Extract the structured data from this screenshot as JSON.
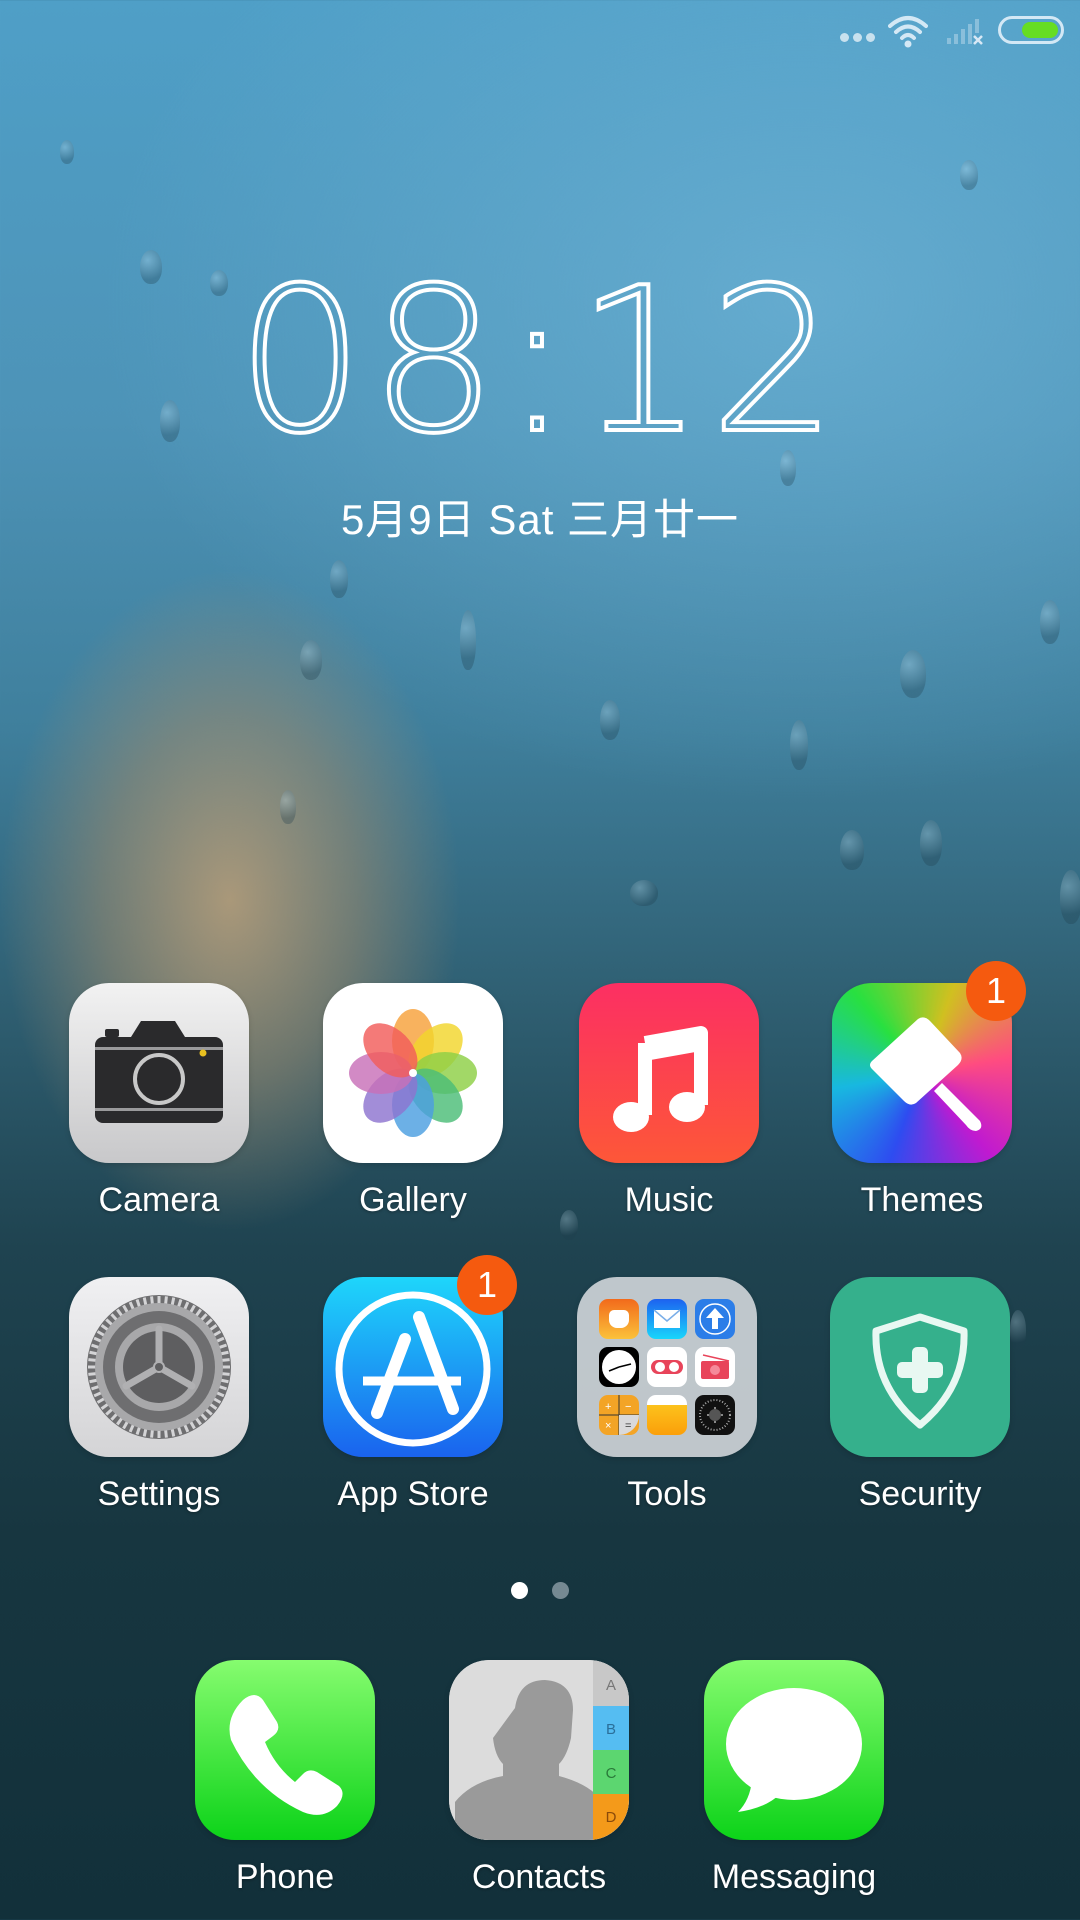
{
  "status_bar": {
    "more_icon": "ellipsis-icon",
    "wifi_icon": "wifi-icon",
    "signal_icon": "no-signal-icon",
    "battery_icon": "battery-icon",
    "battery_level_percent": 60,
    "battery_color": "#66dd22"
  },
  "lockclock": {
    "time": "08:12",
    "date": "5月9日 Sat 三月廿一"
  },
  "apps": [
    {
      "label": "Camera",
      "icon": "camera-icon"
    },
    {
      "label": "Gallery",
      "icon": "photos-flower-icon"
    },
    {
      "label": "Music",
      "icon": "music-note-icon"
    },
    {
      "label": "Themes",
      "icon": "paint-brush-icon",
      "badge": "1"
    },
    {
      "label": "Settings",
      "icon": "gear-icon"
    },
    {
      "label": "App Store",
      "icon": "app-store-icon",
      "badge": "1"
    },
    {
      "label": "Tools",
      "icon": "folder-icon"
    },
    {
      "label": "Security",
      "icon": "shield-plus-icon"
    }
  ],
  "tools_folder": {
    "contents": [
      "mi-icon",
      "mail-icon",
      "update-icon",
      "clock-icon",
      "recorder-icon",
      "radio-icon",
      "calculator-icon",
      "files-icon",
      "compass-icon"
    ]
  },
  "pager": {
    "pages": 2,
    "current": 1
  },
  "dock": [
    {
      "label": "Phone",
      "icon": "phone-icon"
    },
    {
      "label": "Contacts",
      "icon": "contacts-icon",
      "tabs": [
        "A",
        "B",
        "C",
        "D"
      ]
    },
    {
      "label": "Messaging",
      "icon": "message-bubble-icon"
    }
  ],
  "colors": {
    "badge": "#f55a0f",
    "music": "#fc2f63",
    "security": "#35b08c",
    "phone_green": "#0cd319",
    "appstore_blue": "#1a63ee"
  }
}
